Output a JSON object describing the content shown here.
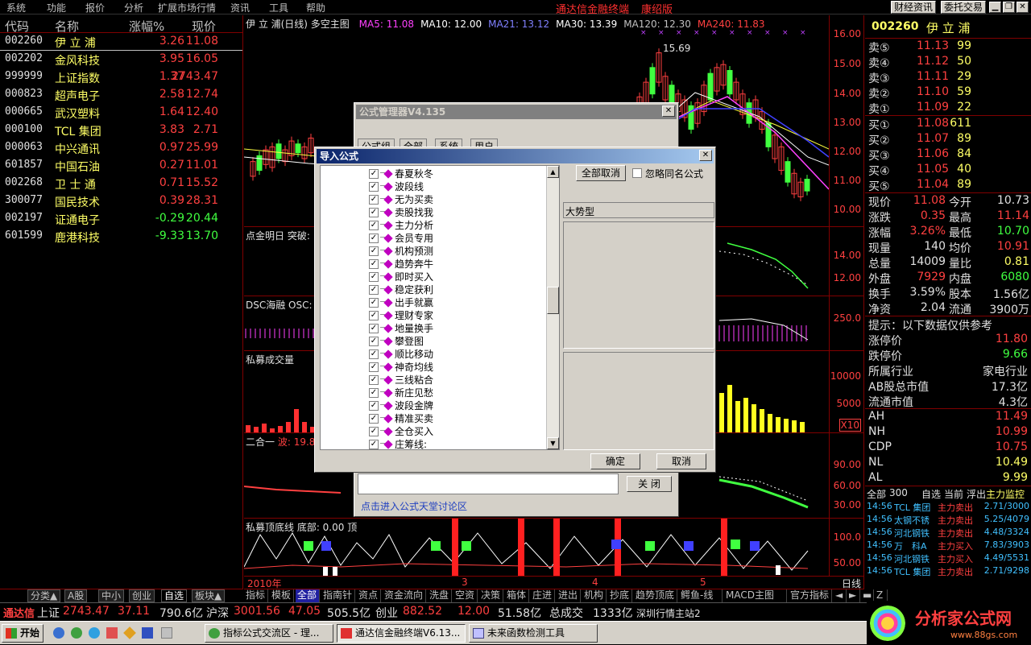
{
  "menu": {
    "items": [
      "系统",
      "功能",
      "报价",
      "分析",
      "扩展市场行情",
      "资讯",
      "工具",
      "帮助"
    ],
    "brand": "通达信金融终端",
    "edition": "康绍版",
    "buttons": [
      "财经资讯",
      "委托交易"
    ]
  },
  "list": {
    "headers": {
      "code": "代码",
      "name": "名称",
      "pct": "涨幅%",
      "price": "现价"
    },
    "rows": [
      {
        "code": "002260",
        "name": "伊 立 浦",
        "pct": "3.26",
        "price": "11.08",
        "dir": "up"
      },
      {
        "code": "002202",
        "name": "金风科技",
        "pct": "3.95",
        "price": "16.05",
        "dir": "up"
      },
      {
        "code": "999999",
        "name": "上证指数",
        "pct": "1.37",
        "price": "2743.47",
        "dir": "up"
      },
      {
        "code": "000823",
        "name": "超声电子",
        "pct": "2.58",
        "price": "12.74",
        "dir": "up"
      },
      {
        "code": "000665",
        "name": "武汉塑料",
        "pct": "1.64",
        "price": "12.40",
        "dir": "up"
      },
      {
        "code": "000100",
        "name": "TCL 集团",
        "pct": "3.83",
        "price": "2.71",
        "dir": "up"
      },
      {
        "code": "000063",
        "name": "中兴通讯",
        "pct": "0.97",
        "price": "25.99",
        "dir": "up"
      },
      {
        "code": "601857",
        "name": "中国石油",
        "pct": "0.27",
        "price": "11.01",
        "dir": "up"
      },
      {
        "code": "002268",
        "name": "卫 士 通",
        "pct": "0.71",
        "price": "15.52",
        "dir": "up"
      },
      {
        "code": "300077",
        "name": "国民技术",
        "pct": "0.39",
        "price": "28.31",
        "dir": "up"
      },
      {
        "code": "002197",
        "name": "证通电子",
        "pct": "-0.29",
        "price": "20.44",
        "dir": "dn"
      },
      {
        "code": "601599",
        "name": "鹿港科技",
        "pct": "-9.33",
        "price": "13.70",
        "dir": "dn"
      }
    ],
    "tabs": [
      "分类▲",
      "A股",
      "中小",
      "创业",
      "自选",
      "板块▲"
    ]
  },
  "chart": {
    "title": "伊 立 浦(日线) 多空主图",
    "ma": [
      {
        "label": "MA5: 11.08",
        "color": "#ff40ff"
      },
      {
        "label": "MA10: 12.00",
        "color": "#ffffff"
      },
      {
        "label": "MA21: 13.12",
        "color": "#8080ff"
      },
      {
        "label": "MA30: 13.39",
        "color": "#ffffff"
      },
      {
        "label": "MA120: 12.30",
        "color": "#c0c0c0"
      },
      {
        "label": "MA240: 11.83",
        "color": "#ff4040"
      }
    ],
    "high_label": "15.69",
    "price_axis": [
      "16.00",
      "15.00",
      "14.00",
      "13.00",
      "12.00",
      "11.00",
      "10.00"
    ],
    "panel2_title": "点金明日 突破:",
    "panel2_axis": [
      "14.00",
      "12.00"
    ],
    "panel3_title": "DSC海融 OSC:",
    "panel3_axis": [
      "250.0"
    ],
    "panel4_title": "私募成交量",
    "panel4_axis": [
      "10000",
      "5000"
    ],
    "panel4_unit": "X10",
    "panel5_title": "二合一",
    "panel5_sub": "波: 19.8",
    "panel5_axis": [
      "90.00",
      "60.00",
      "30.00"
    ],
    "panel6_title": "私募顶底线 底部: 0.00 顶",
    "panel6_axis": [
      "100.0",
      "50.00"
    ],
    "time_labels": [
      "2010年",
      "3",
      "4",
      "5"
    ],
    "period": "日线",
    "bottom_tabs": [
      "指标",
      "模板",
      "全部",
      "指南针",
      "资点",
      "资金流向",
      "洗盘",
      "空资",
      "决策",
      "箱体",
      "庄进",
      "进出",
      "机构",
      "抄底",
      "趋势顶底",
      "鳄鱼-线",
      "MACD主图",
      "官方指标"
    ],
    "bottom_controls": [
      "◄",
      "►",
      "▬",
      "Z"
    ]
  },
  "quote": {
    "code": "002260",
    "name": "伊 立 浦",
    "sells": [
      {
        "label": "卖⑤",
        "price": "11.13",
        "vol": "99"
      },
      {
        "label": "卖④",
        "price": "11.12",
        "vol": "50"
      },
      {
        "label": "卖③",
        "price": "11.11",
        "vol": "29"
      },
      {
        "label": "卖②",
        "price": "11.10",
        "vol": "59"
      },
      {
        "label": "卖①",
        "price": "11.09",
        "vol": "22"
      }
    ],
    "buys": [
      {
        "label": "买①",
        "price": "11.08",
        "vol": "611"
      },
      {
        "label": "买②",
        "price": "11.07",
        "vol": "89"
      },
      {
        "label": "买③",
        "price": "11.06",
        "vol": "84"
      },
      {
        "label": "买④",
        "price": "11.05",
        "vol": "40"
      },
      {
        "label": "买⑤",
        "price": "11.04",
        "vol": "89"
      }
    ],
    "stats": [
      {
        "l1": "现价",
        "v1": "11.08",
        "c1": "up",
        "l2": "今开",
        "v2": "10.73",
        "c2": "wh"
      },
      {
        "l1": "涨跌",
        "v1": "0.35",
        "c1": "up",
        "l2": "最高",
        "v2": "11.14",
        "c2": "up"
      },
      {
        "l1": "涨幅",
        "v1": "3.26%",
        "c1": "up",
        "l2": "最低",
        "v2": "10.70",
        "c2": "dn"
      },
      {
        "l1": "现量",
        "v1": "140",
        "c1": "wh",
        "l2": "均价",
        "v2": "10.91",
        "c2": "up"
      },
      {
        "l1": "总量",
        "v1": "14009",
        "c1": "wh",
        "l2": "量比",
        "v2": "0.81",
        "c2": "yl"
      },
      {
        "l1": "外盘",
        "v1": "7929",
        "c1": "up",
        "l2": "内盘",
        "v2": "6080",
        "c2": "dn"
      },
      {
        "l1": "换手",
        "v1": "3.59%",
        "c1": "wh",
        "l2": "股本",
        "v2": "1.56亿",
        "c2": "wh"
      },
      {
        "l1": "净资",
        "v1": "2.04",
        "c1": "wh",
        "l2": "流通",
        "v2": "3900万",
        "c2": "wh"
      }
    ],
    "tip": "提示：以下数据仅供参考",
    "limits": [
      {
        "l": "涨停价",
        "v": "11.80",
        "c": "up"
      },
      {
        "l": "跌停价",
        "v": "9.66",
        "c": "dn"
      },
      {
        "l": "所属行业",
        "v": "家电行业",
        "c": "wh"
      },
      {
        "l": "AB股总市值",
        "v": "17.3亿",
        "c": "wh"
      },
      {
        "l": "流通市值",
        "v": "4.3亿",
        "c": "wh"
      }
    ],
    "indicators": [
      {
        "l": "AH",
        "v": "11.49",
        "c": "up"
      },
      {
        "l": "NH",
        "v": "10.99",
        "c": "up"
      },
      {
        "l": "CDP",
        "v": "10.75",
        "c": "up"
      },
      {
        "l": "NL",
        "v": "10.49",
        "c": "yl"
      },
      {
        "l": "AL",
        "v": "9.99",
        "c": "yl"
      }
    ],
    "tick_tabs": [
      "全部",
      "300",
      "自选",
      "当前",
      "浮出",
      "主力监控"
    ],
    "ticks": [
      {
        "t": "14:56",
        "n": "TCL 集团",
        "a": "主力卖出",
        "v": "2.71/3000"
      },
      {
        "t": "14:56",
        "n": "太钢不锈",
        "a": "主力卖出",
        "v": "5.25/4079"
      },
      {
        "t": "14:56",
        "n": "河北钢铁",
        "a": "主力卖出",
        "v": "4.48/3324"
      },
      {
        "t": "14:56",
        "n": "万　科A",
        "a": "主力买入",
        "v": "7.83/3903"
      },
      {
        "t": "14:56",
        "n": "河北钢铁",
        "a": "主力买入",
        "v": "4.49/5531"
      },
      {
        "t": "14:56",
        "n": "TCL 集团",
        "a": "主力卖出",
        "v": "2.71/9298"
      }
    ]
  },
  "status": {
    "brand": "通达信",
    "sh_label": "上证",
    "sh_val": "2743.47",
    "sh_chg": "37.11",
    "sh_amt": "790.6亿",
    "sz_label": "沪深",
    "sz_val": "3001.56",
    "sz_chg": "47.05",
    "sz_amt": "505.5亿",
    "cy_label": "创业",
    "cy_val": "882.52",
    "cy_chg": "12.00",
    "cy_amt": "51.58亿",
    "total_label": "总成交",
    "total_val": "1333亿",
    "server": "深圳行情主站2"
  },
  "taskbar": {
    "start": "开始",
    "tasks": [
      "指标公式交流区 - 理...",
      "通达信金融终端V6.13...",
      "未来函数检测工具"
    ],
    "logo": "分析家公式网",
    "logo_url": "www.88gs.com"
  },
  "formula_manager": {
    "title": "公式管理器V4.135",
    "tabs": [
      "公式组",
      "全部",
      "系统",
      "用户"
    ],
    "link": "点击进入公式天堂讨论区",
    "close_btn": "关 闭"
  },
  "import_dialog": {
    "title": "导入公式",
    "items": [
      "春夏秋冬",
      "波段线",
      "无为买卖",
      "卖股找我",
      "主力分析",
      "会员专用",
      "机构预测",
      "趋势奔牛",
      "即时买入",
      "稳定获利",
      "出手就赢",
      "理财专家",
      "地量换手",
      "攀登图",
      "顺比移动",
      "神奇均线",
      "三线粘合",
      "新庄见愁",
      "波段金牌",
      "精准买卖",
      "全仓买入",
      "庄筹线:"
    ],
    "deselect_all": "全部取消",
    "ignore_same": "忽略同名公式",
    "category": "大势型",
    "ok": "确定",
    "cancel": "取消"
  }
}
